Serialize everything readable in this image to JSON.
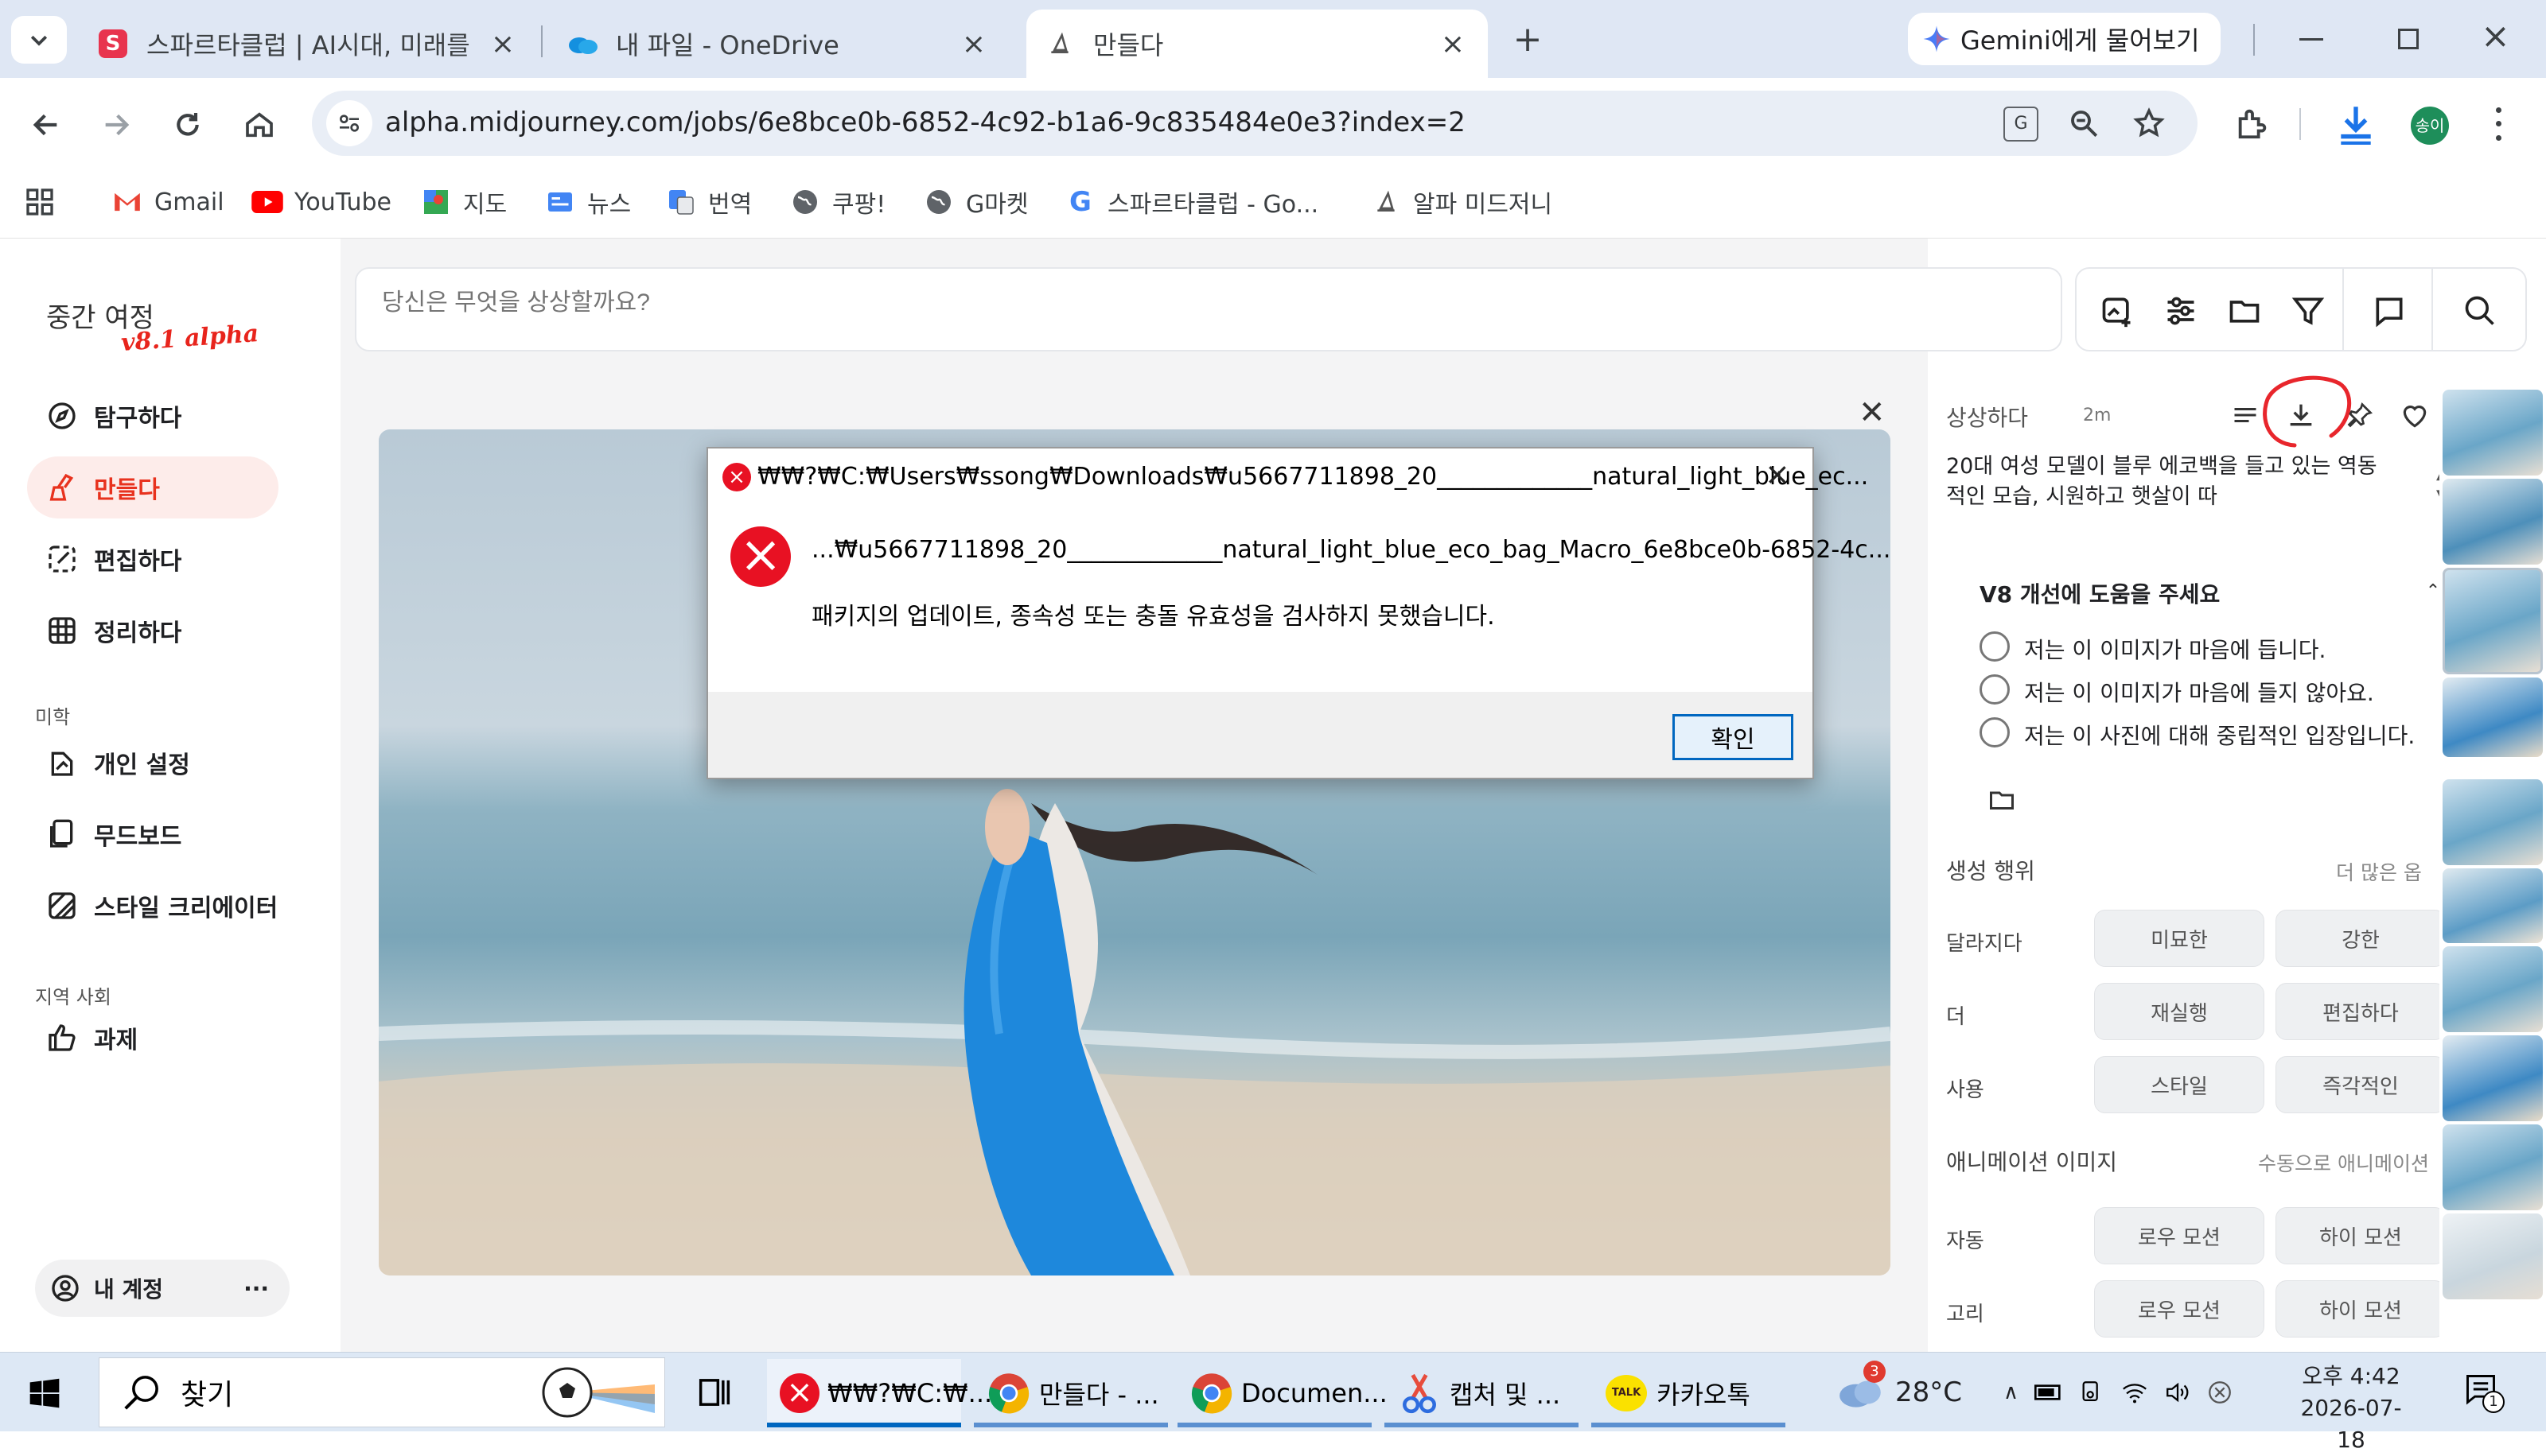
{
  "browser": {
    "tabs": [
      {
        "title": "스파르타클럽 | AI시대, 미래를",
        "active": false
      },
      {
        "title": "내 파일 - OneDrive",
        "active": false
      },
      {
        "title": "만들다",
        "active": true
      }
    ],
    "new_tab": "+",
    "gemini_label": "Gemini에게 물어보기",
    "url": "alpha.midjourney.com/jobs/6e8bce0b-6852-4c92-b1a6-9c835484e0e3?index=2",
    "profile": "송이",
    "bookmarks": [
      "Gmail",
      "YouTube",
      "지도",
      "뉴스",
      "번역",
      "쿠팡!",
      "G마켓",
      "스파르타클럽 - Go...",
      "알파 미드저니"
    ]
  },
  "sidebar": {
    "logo": "중간 여정",
    "logo_sub": "v8.1 alpha",
    "items": [
      {
        "label": "탐구하다",
        "icon": "compass-icon"
      },
      {
        "label": "만들다",
        "icon": "brush-icon",
        "active": true
      },
      {
        "label": "편집하다",
        "icon": "edit-icon"
      },
      {
        "label": "정리하다",
        "icon": "grid-icon"
      }
    ],
    "section_aesthetics": "미학",
    "aesthetics": [
      {
        "label": "개인 설정",
        "icon": "personalize-icon"
      },
      {
        "label": "무드보드",
        "icon": "moodboard-icon"
      },
      {
        "label": "스타일 크리에이터",
        "icon": "style-creator-icon"
      }
    ],
    "section_community": "지역 사회",
    "community": [
      {
        "label": "과제",
        "icon": "thumbs-up-icon"
      }
    ],
    "account": "내 계정",
    "account_more": "···"
  },
  "search": {
    "placeholder": "당신은 무엇을 상상할까요?"
  },
  "right_panel": {
    "header": "상상하다",
    "age": "2m",
    "prompt": "20대 여성 모델이 블루 에코백을 들고 있는 역동적인 모습, 시원하고 햇살이 따",
    "feedback_title": "V8 개선에 도움을 주세요",
    "feedback_options": [
      "저는 이 이미지가 마음에 듭니다.",
      "저는 이 이미지가 마음에 들지 않아요.",
      "저는 이 사진에 대해 중립적인 입장입니다."
    ],
    "creation_title": "생성 행위",
    "creation_more": "더 많은 옵",
    "rows": [
      {
        "label": "달라지다",
        "a": "미묘한",
        "b": "강한"
      },
      {
        "label": "더",
        "a": "재실행",
        "b": "편집하다"
      },
      {
        "label": "사용",
        "a": "스타일",
        "b": "즉각적인"
      }
    ],
    "animate_title": "애니메이션 이미지",
    "animate_more": "수동으로 애니메이션",
    "anim_rows": [
      {
        "label": "자동",
        "a": "로우 모션",
        "b": "하이 모션"
      },
      {
        "label": "고리",
        "a": "로우 모션",
        "b": "하이 모션"
      }
    ]
  },
  "dialog": {
    "title": "₩₩?₩C:₩Users₩ssong₩Downloads₩u5667711898_20_____________natural_light_blue_ec...",
    "path": "...₩u5667711898_20_____________natural_light_blue_eco_bag_Macro_6e8bce0b-6852-4c...",
    "message": "패키지의 업데이트, 종속성 또는 충돌 유효성을 검사하지 못했습니다.",
    "ok": "확인"
  },
  "taskbar": {
    "search": "찾기",
    "items": [
      "₩₩?₩C:₩...",
      "만들다 - ...",
      "Documen...",
      "캡처 및 ...",
      "카카오톡"
    ],
    "weather_badge": "3",
    "temperature": "28°C",
    "time": "오후 4:42",
    "date": "2026-07-18",
    "notif_badge": "1"
  },
  "colors": {
    "accent_red": "#e81123",
    "active_nav_bg": "#fdecea",
    "brand_orange": "#f2542d",
    "win_blue": "#0067c0"
  }
}
